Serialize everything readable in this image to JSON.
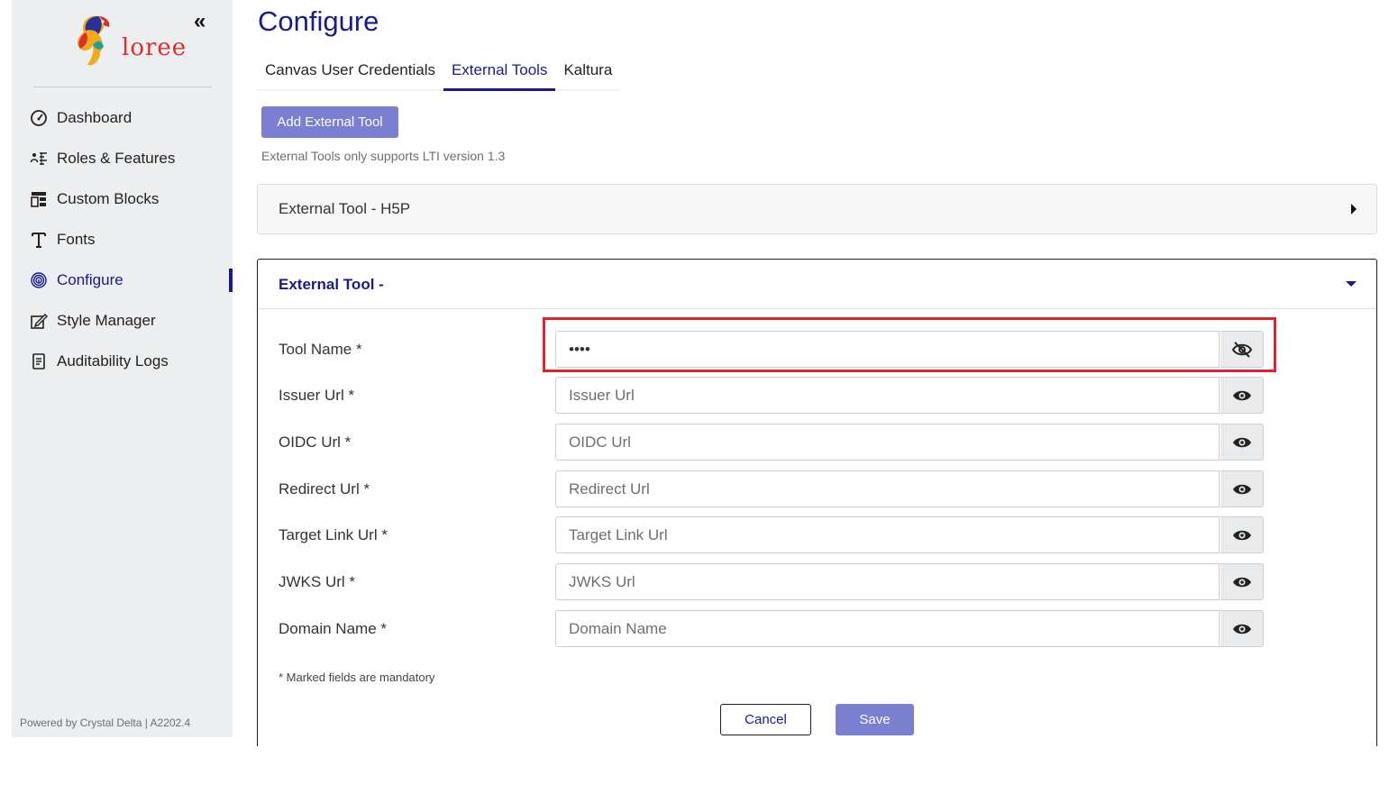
{
  "brand": {
    "logo_text": "loree",
    "collapse_label": "«"
  },
  "sidebar": {
    "items": [
      {
        "label": "Dashboard",
        "icon": "dashboard-gauge-icon",
        "active": false
      },
      {
        "label": "Roles & Features",
        "icon": "roles-features-icon",
        "active": false
      },
      {
        "label": "Custom Blocks",
        "icon": "custom-blocks-icon",
        "active": false
      },
      {
        "label": "Fonts",
        "icon": "fonts-icon",
        "active": false
      },
      {
        "label": "Configure",
        "icon": "configure-fingerprint-icon",
        "active": true
      },
      {
        "label": "Style Manager",
        "icon": "style-manager-icon",
        "active": false
      },
      {
        "label": "Auditability Logs",
        "icon": "auditability-logs-icon",
        "active": false
      }
    ],
    "footer": "Powered by Crystal Delta | A2202.4"
  },
  "main": {
    "title": "Configure",
    "tabs": [
      {
        "label": "Canvas User Credentials",
        "active": false
      },
      {
        "label": "External Tools",
        "active": true
      },
      {
        "label": "Kaltura",
        "active": false
      }
    ],
    "add_button": "Add External Tool",
    "hint": "External Tools only supports LTI version 1.3",
    "tools": [
      {
        "title": "External Tool - H5P",
        "expanded": false
      },
      {
        "title": "External Tool -",
        "expanded": true
      }
    ],
    "form": {
      "fields": [
        {
          "label": "Tool Name *",
          "value": "••••",
          "placeholder": "",
          "eye": "eye-slash-icon"
        },
        {
          "label": "Issuer Url *",
          "value": "",
          "placeholder": "Issuer Url",
          "eye": "eye-icon"
        },
        {
          "label": "OIDC Url *",
          "value": "",
          "placeholder": "OIDC Url",
          "eye": "eye-icon"
        },
        {
          "label": "Redirect Url *",
          "value": "",
          "placeholder": "Redirect Url",
          "eye": "eye-icon"
        },
        {
          "label": "Target Link Url *",
          "value": "",
          "placeholder": "Target Link Url",
          "eye": "eye-icon"
        },
        {
          "label": "JWKS Url *",
          "value": "",
          "placeholder": "JWKS Url",
          "eye": "eye-icon"
        },
        {
          "label": "Domain Name *",
          "value": "",
          "placeholder": "Domain Name",
          "eye": "eye-icon"
        }
      ],
      "mandatory_note": "* Marked fields are mandatory",
      "cancel_label": "Cancel",
      "save_label": "Save"
    }
  },
  "colors": {
    "accent": "#1a1a8c",
    "button": "#7b7fd1",
    "highlight": "#e0232d",
    "sidebar_bg": "#eceef0"
  }
}
